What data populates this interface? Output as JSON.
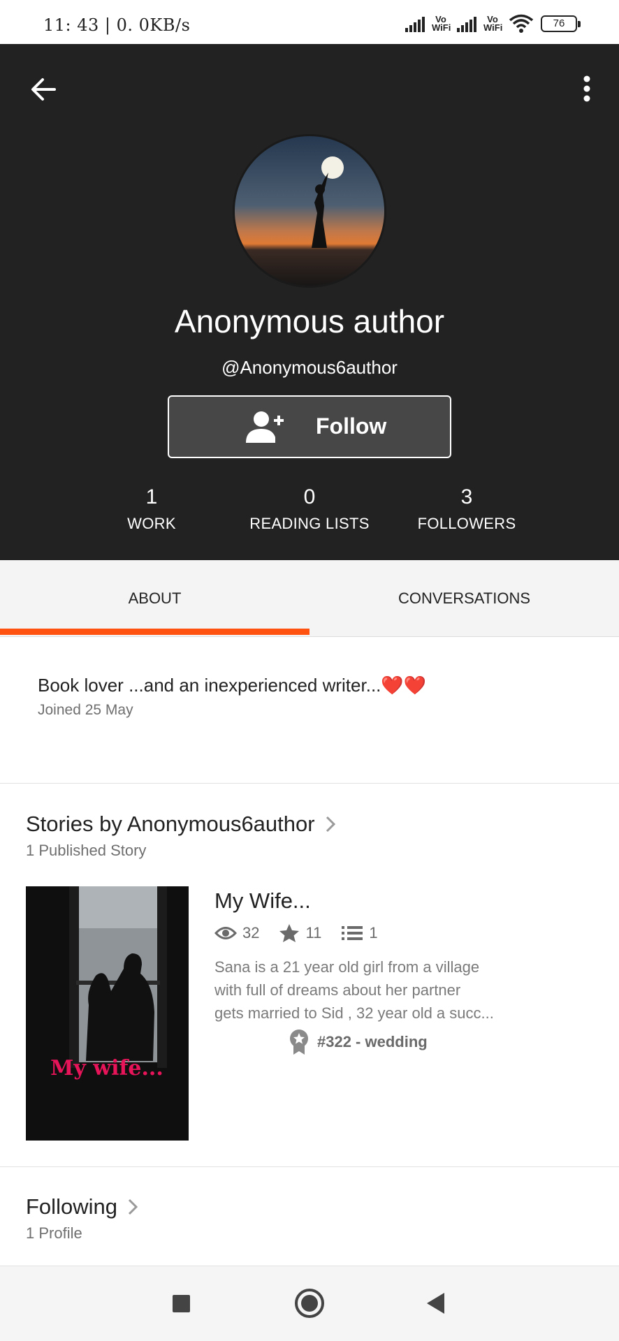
{
  "status_bar": {
    "time": "11: 43 | 0. 0KB/s",
    "vowifi_1": "Vo WiFi",
    "vowifi_2": "Vo WiFi",
    "battery": "76"
  },
  "profile": {
    "display_name": "Anonymous author",
    "username": "@Anonymous6author",
    "follow_label": "Follow",
    "stats": [
      {
        "value": "1",
        "label": "WORK"
      },
      {
        "value": "0",
        "label": "READING LISTS"
      },
      {
        "value": "3",
        "label": "FOLLOWERS"
      }
    ]
  },
  "tabs": [
    {
      "label": "ABOUT",
      "active": true
    },
    {
      "label": "CONVERSATIONS",
      "active": false
    }
  ],
  "about": {
    "bio": "Book lover ...and an inexperienced writer...❤️❤️",
    "joined": "Joined 25 May"
  },
  "stories": {
    "title": "Stories by Anonymous6author",
    "subtitle": "1 Published Story",
    "items": [
      {
        "title": "My Wife...",
        "cover_text": "My wife...",
        "reads": "32",
        "votes": "11",
        "parts": "1",
        "description_lines": [
          "Sana is a 21 year old girl from a village",
          "with full of dreams about her partner",
          "gets married to Sid , 32 year old a succ..."
        ],
        "rank": "#322 - wedding"
      }
    ]
  },
  "following": {
    "title": "Following",
    "subtitle": "1 Profile"
  },
  "colors": {
    "header_bg": "#222222",
    "accent": "#ff5211",
    "cover_text": "#e8145a"
  }
}
